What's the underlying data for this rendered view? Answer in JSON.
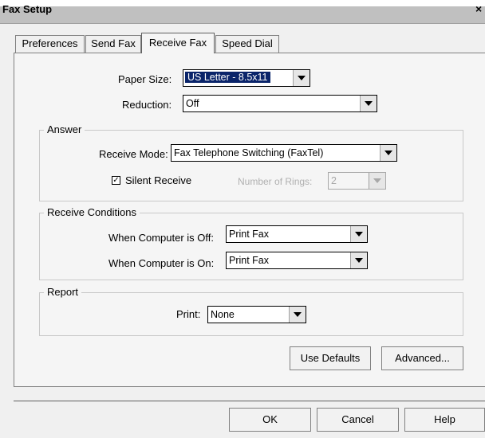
{
  "window": {
    "title": "Fax Setup",
    "close_glyph": "×"
  },
  "tabs": [
    {
      "label": "Preferences",
      "active": false
    },
    {
      "label": "Send Fax",
      "active": false
    },
    {
      "label": "Receive Fax",
      "active": true
    },
    {
      "label": "Speed Dial",
      "active": false
    }
  ],
  "paper_size": {
    "label": "Paper Size:",
    "value": "US Letter - 8.5x11"
  },
  "reduction": {
    "label": "Reduction:",
    "value": "Off"
  },
  "answer": {
    "legend": "Answer",
    "receive_mode": {
      "label": "Receive Mode:",
      "value": "Fax Telephone Switching (FaxTel)"
    },
    "silent_receive": {
      "label": "Silent Receive",
      "checked": true
    },
    "rings": {
      "label": "Number of Rings:",
      "value": "2",
      "disabled": true
    }
  },
  "receive_conditions": {
    "legend": "Receive Conditions",
    "computer_off": {
      "label": "When Computer is Off:",
      "value": "Print Fax"
    },
    "computer_on": {
      "label": "When Computer is On:",
      "value": "Print Fax"
    }
  },
  "report": {
    "legend": "Report",
    "print": {
      "label": "Print:",
      "value": "None"
    }
  },
  "buttons": {
    "use_defaults": "Use Defaults",
    "advanced": "Advanced...",
    "ok": "OK",
    "cancel": "Cancel",
    "help": "Help"
  },
  "icons": {
    "close": "close-icon",
    "dropdown": "chevron-down-icon",
    "check": "checkmark-icon"
  }
}
